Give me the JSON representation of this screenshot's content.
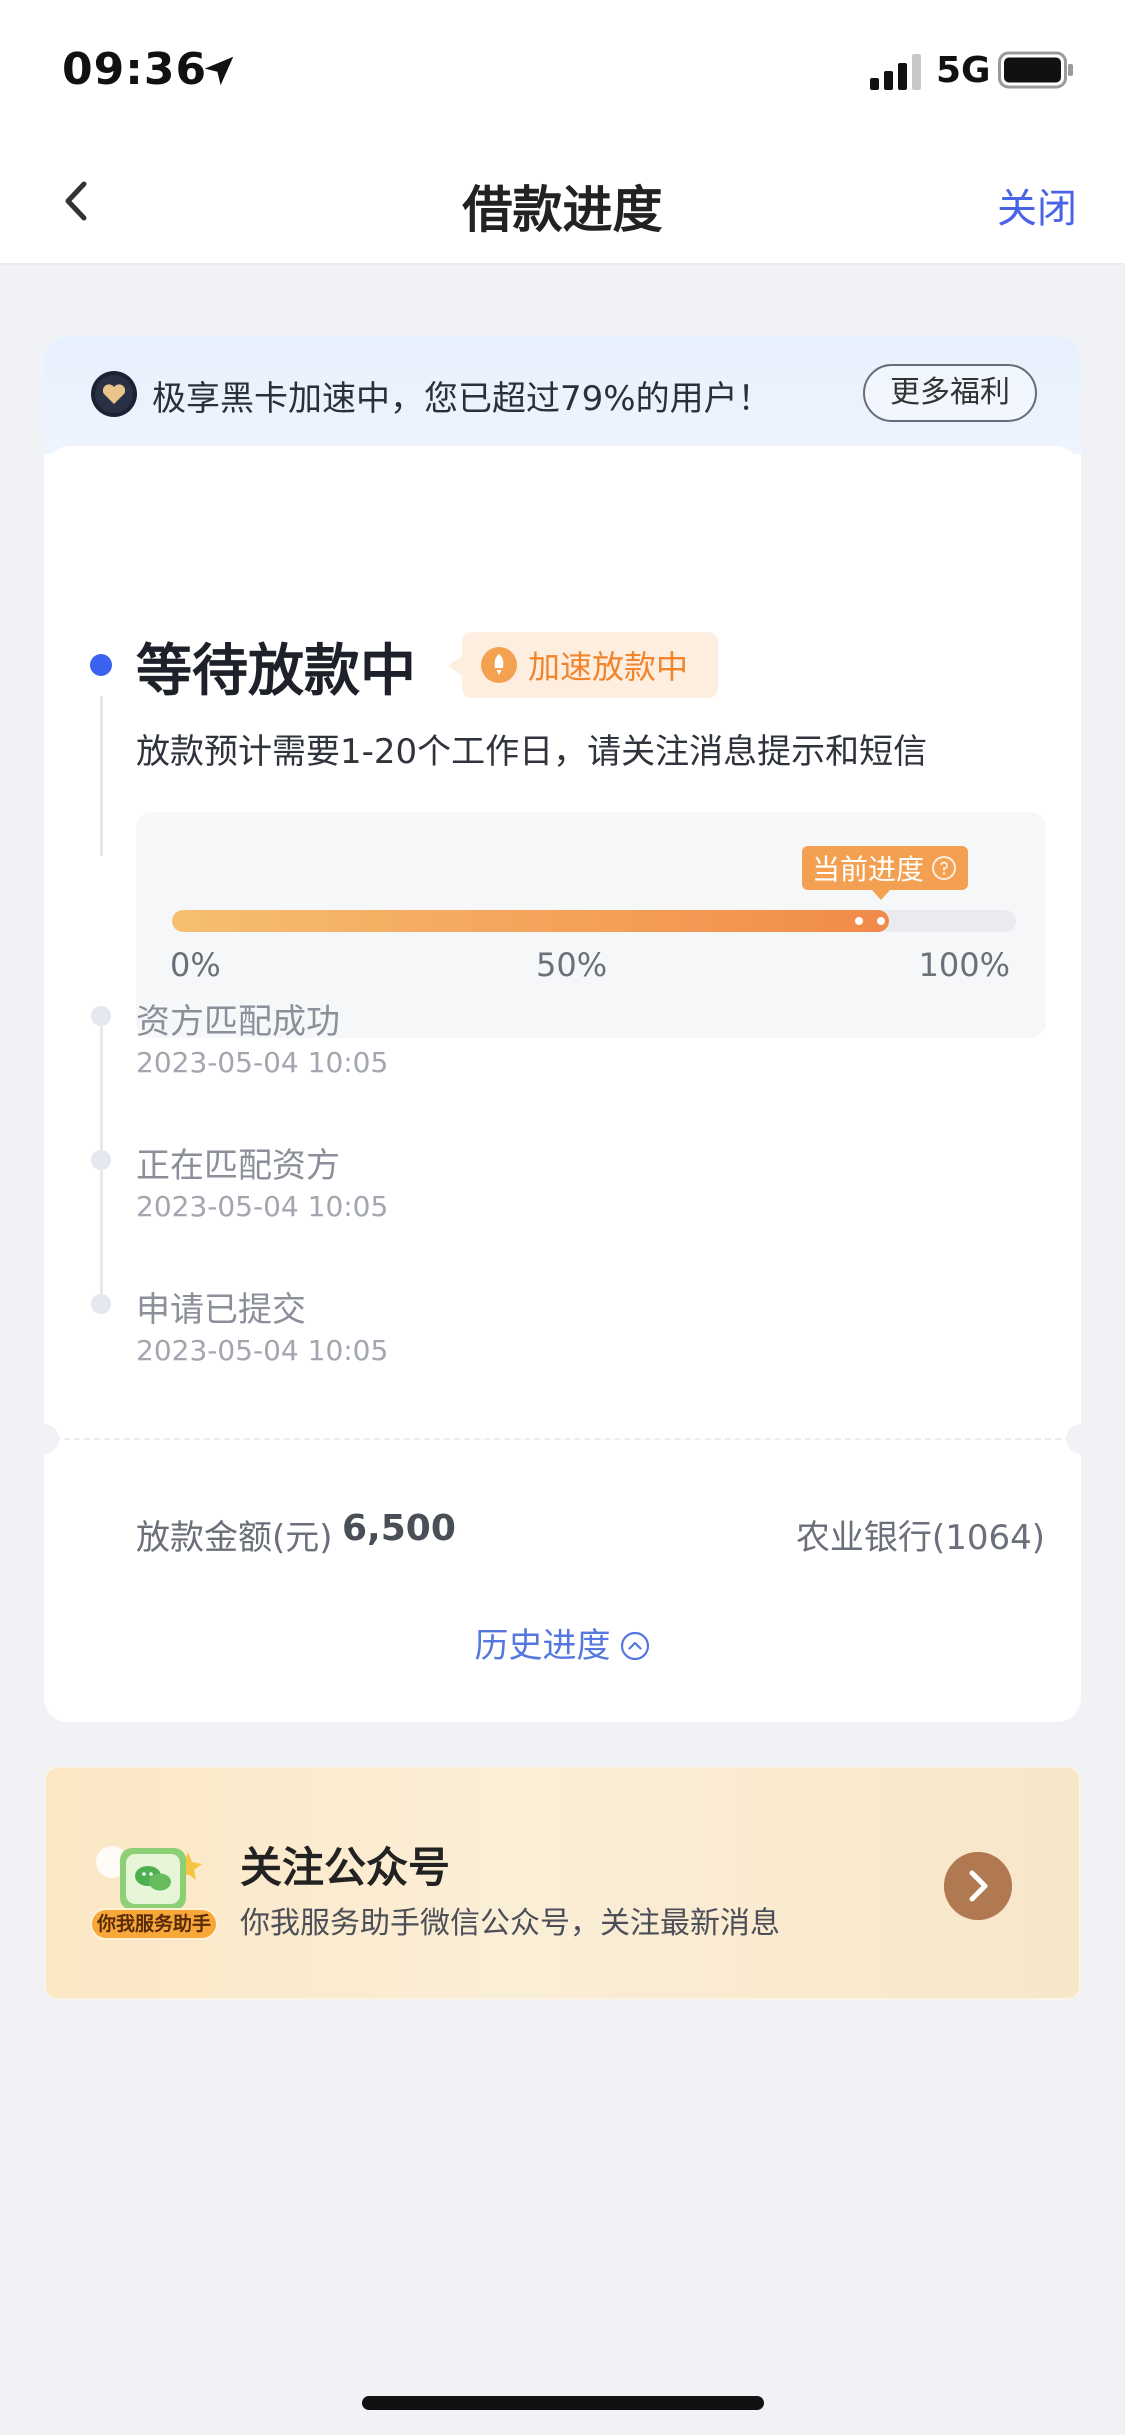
{
  "status_bar": {
    "time": "09:36",
    "network": "5G",
    "icons": [
      "location-arrow-icon",
      "signal-icon",
      "battery-icon"
    ]
  },
  "nav": {
    "title": "借款进度",
    "close_label": "关闭",
    "back_icon": "chevron-left-icon"
  },
  "banner": {
    "text": "极享黑卡加速中，您已超过79%的用户！",
    "more_button": "更多福利"
  },
  "current_status": {
    "title": "等待放款中",
    "badge": "加速放款中",
    "description": "放款预计需要1-20个工作日，请关注消息提示和短信"
  },
  "progress": {
    "tip_label": "当前进度",
    "value_percent": 85,
    "labels": [
      "0%",
      "50%",
      "100%"
    ]
  },
  "timeline": [
    {
      "title": "资方匹配成功",
      "time": "2023-05-04 10:05"
    },
    {
      "title": "正在匹配资方",
      "time": "2023-05-04 10:05"
    },
    {
      "title": "申请已提交",
      "time": "2023-05-04 10:05"
    }
  ],
  "loan": {
    "amount_label": "放款金额(元)",
    "amount_value": "6,500",
    "bank": "农业银行(1064)"
  },
  "history_link": "历史进度",
  "promo": {
    "tag": "你我服务助手",
    "title": "关注公众号",
    "subtitle": "你我服务助手微信公众号，关注最新消息"
  },
  "colors": {
    "accent_blue": "#3c63f0",
    "link_blue": "#5577e0",
    "orange": "#f28a49",
    "badge_bg": "#fdeee0"
  }
}
